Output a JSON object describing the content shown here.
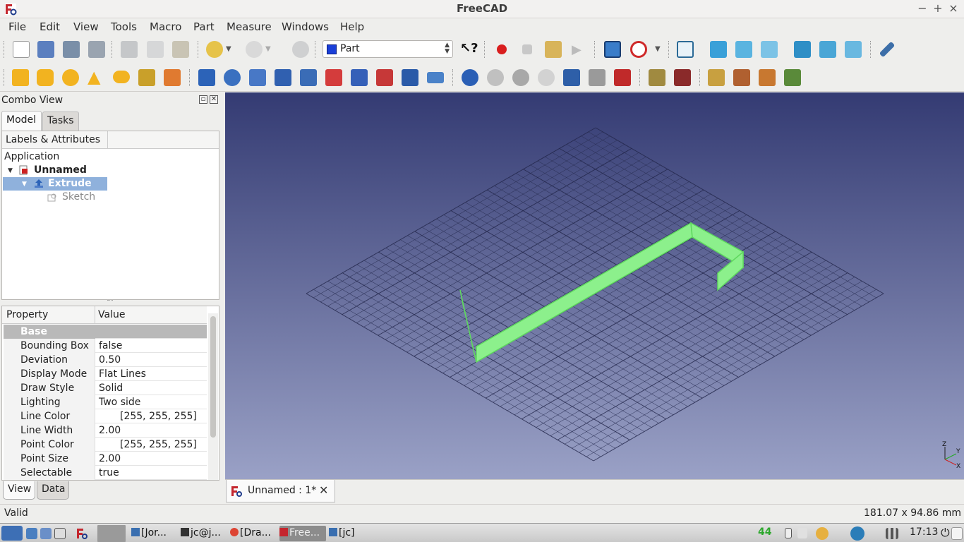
{
  "window": {
    "title": "FreeCAD",
    "controls": [
      "−",
      "+",
      "×"
    ]
  },
  "menu": [
    "File",
    "Edit",
    "View",
    "Tools",
    "Macro",
    "Part",
    "Measure",
    "Windows",
    "Help"
  ],
  "toolbar": {
    "workbench": "Part"
  },
  "combo": {
    "title": "Combo View",
    "tabs": [
      "Model",
      "Tasks"
    ],
    "tree": {
      "header": "Labels & Attributes",
      "root": "Application",
      "document": "Unnamed",
      "object": "Extrude",
      "child": "Sketch"
    },
    "properties": {
      "headers": [
        "Property",
        "Value"
      ],
      "group": "Base",
      "rows": [
        {
          "key": "Bounding Box",
          "value": "false"
        },
        {
          "key": "Deviation",
          "value": "0.50"
        },
        {
          "key": "Display Mode",
          "value": "Flat Lines"
        },
        {
          "key": "Draw Style",
          "value": "Solid"
        },
        {
          "key": "Lighting",
          "value": "Two side"
        },
        {
          "key": "Line Color",
          "value": "[255, 255, 255]"
        },
        {
          "key": "Line Width",
          "value": "2.00"
        },
        {
          "key": "Point Color",
          "value": "[255, 255, 255]"
        },
        {
          "key": "Point Size",
          "value": "2.00"
        },
        {
          "key": "Selectable",
          "value": "true"
        }
      ]
    },
    "view_tabs": [
      "View",
      "Data"
    ]
  },
  "viewport": {
    "shape_color": "#8cf08c",
    "axis_labels": [
      "Z",
      "Y",
      "X"
    ]
  },
  "doc_tab": {
    "label": "Unnamed : 1*",
    "close": "✕"
  },
  "status": {
    "message": "Valid",
    "dimensions": "181.07 x 94.86 mm"
  },
  "taskbar": {
    "tasks": [
      "[Jor...",
      "jc@j...",
      "[Dra...",
      "Free...",
      "[jc]"
    ],
    "volume": "44",
    "clock": "17:13"
  }
}
